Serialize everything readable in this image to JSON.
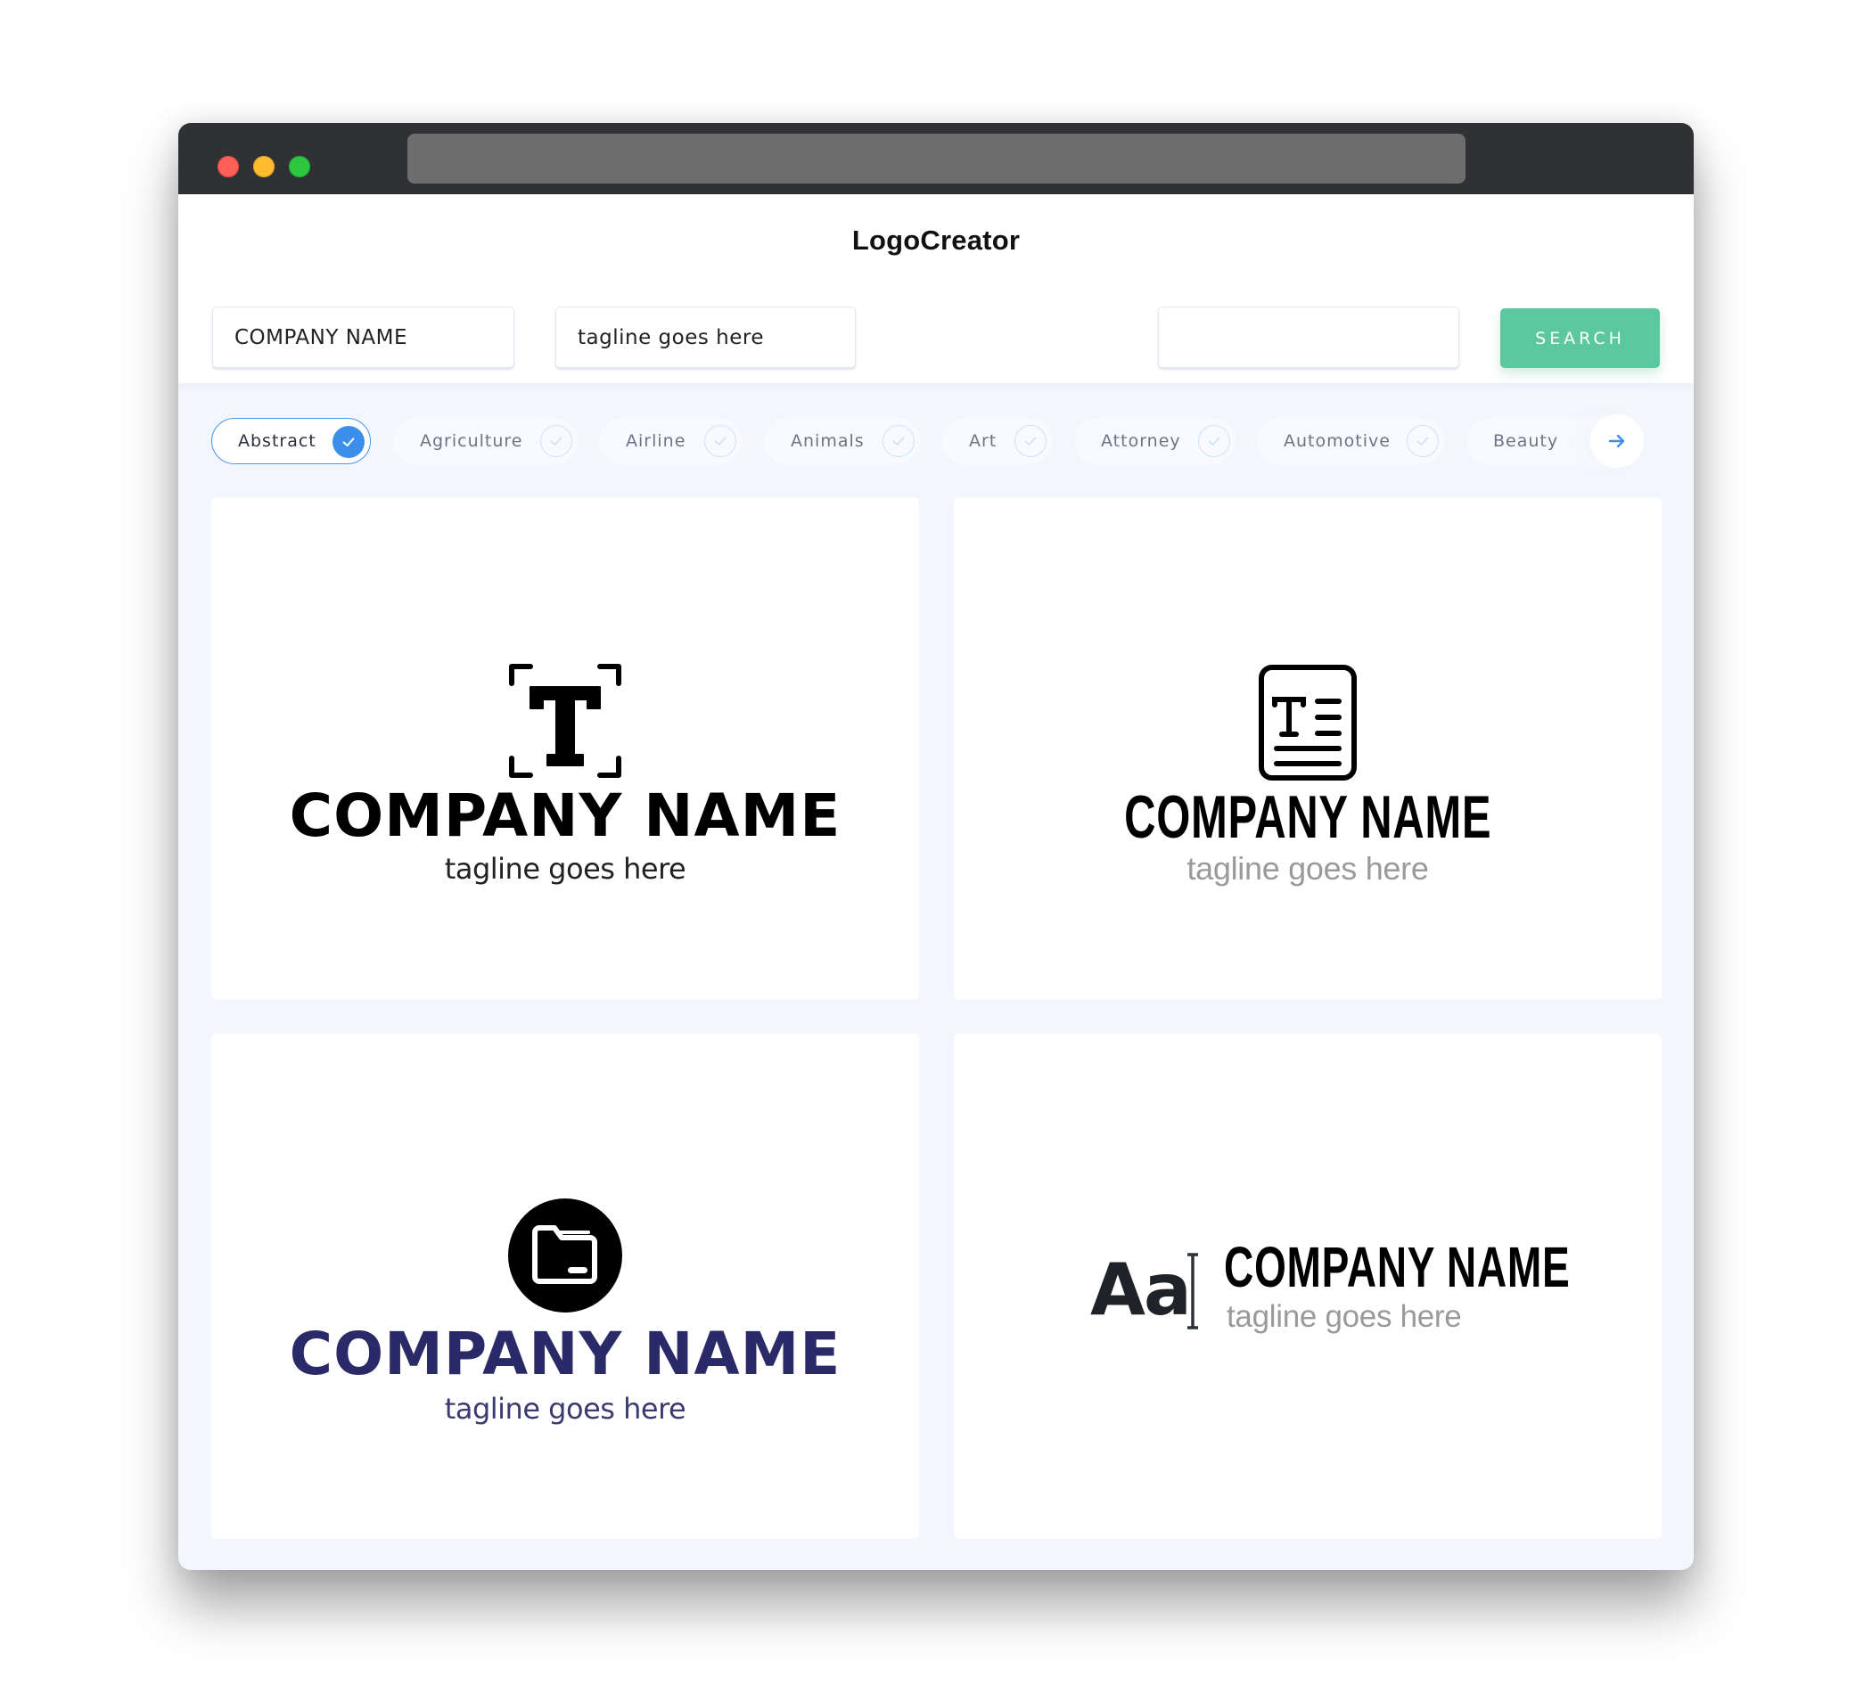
{
  "browser": {
    "traffic_lights": [
      "close",
      "minimize",
      "maximize"
    ],
    "url": ""
  },
  "header": {
    "brand": "LogoCreator"
  },
  "search": {
    "company_value": "COMPANY NAME",
    "tagline_value": "tagline goes here",
    "keyword_value": "",
    "button_label": "SEARCH"
  },
  "categories": {
    "items": [
      {
        "label": "Abstract",
        "selected": true
      },
      {
        "label": "Agriculture",
        "selected": false
      },
      {
        "label": "Airline",
        "selected": false
      },
      {
        "label": "Animals",
        "selected": false
      },
      {
        "label": "Art",
        "selected": false
      },
      {
        "label": "Attorney",
        "selected": false
      },
      {
        "label": "Automotive",
        "selected": false
      },
      {
        "label": "Beauty",
        "selected": false
      }
    ],
    "next_icon": "arrow-right-icon"
  },
  "logos": [
    {
      "icon": "text-frame-icon",
      "company": "COMPANY NAME",
      "tagline": "tagline goes here",
      "name_color": "#000000",
      "tagline_color": "#222222"
    },
    {
      "icon": "text-document-icon",
      "company": "COMPANY NAME",
      "tagline": "tagline goes here",
      "name_color": "#000000",
      "tagline_color": "#9a9a9a"
    },
    {
      "icon": "folder-circle-icon",
      "company": "COMPANY NAME",
      "tagline": "tagline goes here",
      "name_color": "#2a2a68",
      "tagline_color": "#3b3b72"
    },
    {
      "icon": "font-aa-cursor-icon",
      "icon_text": "Aa",
      "company": "COMPANY NAME",
      "tagline": "tagline goes here",
      "name_color": "#000000",
      "tagline_color": "#9a9a9a"
    }
  ],
  "colors": {
    "accent_green": "#5bc8a0",
    "accent_blue": "#3b8eea",
    "background": "#f3f6fd"
  }
}
